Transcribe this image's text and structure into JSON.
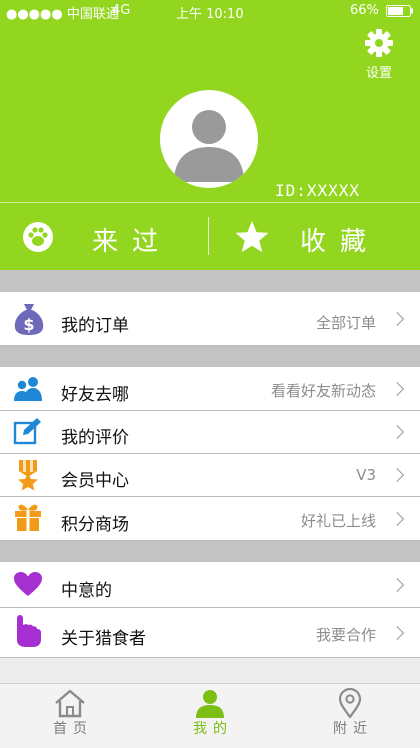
{
  "status_bar": {
    "signal": "●●●●● 中国联通",
    "network": "4G",
    "time": "上午 10:10",
    "battery": "66%"
  },
  "header": {
    "settings_label": "设置",
    "user_id": "ID:XXXXX"
  },
  "quick_actions": [
    {
      "label": "来过",
      "icon": "paw-icon"
    },
    {
      "label": "收藏",
      "icon": "star-icon"
    }
  ],
  "menu": {
    "orders": {
      "label": "我的订单",
      "value": "全部订单",
      "icon": "money-bag-icon"
    },
    "friends": {
      "label": "好友去哪",
      "value": "看看好友新动态",
      "icon": "friends-icon"
    },
    "reviews": {
      "label": "我的评价",
      "value": "",
      "icon": "edit-icon"
    },
    "member": {
      "label": "会员中心",
      "value": "V3",
      "icon": "medal-icon"
    },
    "points": {
      "label": "积分商场",
      "value": "好礼已上线",
      "icon": "gift-icon"
    },
    "favorites": {
      "label": "中意的",
      "value": "",
      "icon": "heart-icon"
    },
    "about": {
      "label": "关于猎食者",
      "value": "我要合作",
      "icon": "pointer-hand-icon"
    }
  },
  "tabbar": [
    {
      "label": "首页",
      "icon": "home-icon",
      "active": false
    },
    {
      "label": "我的",
      "icon": "user-icon",
      "active": true
    },
    {
      "label": "附近",
      "icon": "location-pin-icon",
      "active": false
    }
  ],
  "colors": {
    "brand_green": "#93d61f",
    "section_gray": "#c3c3c3",
    "tab_active": "#7bbf15"
  }
}
